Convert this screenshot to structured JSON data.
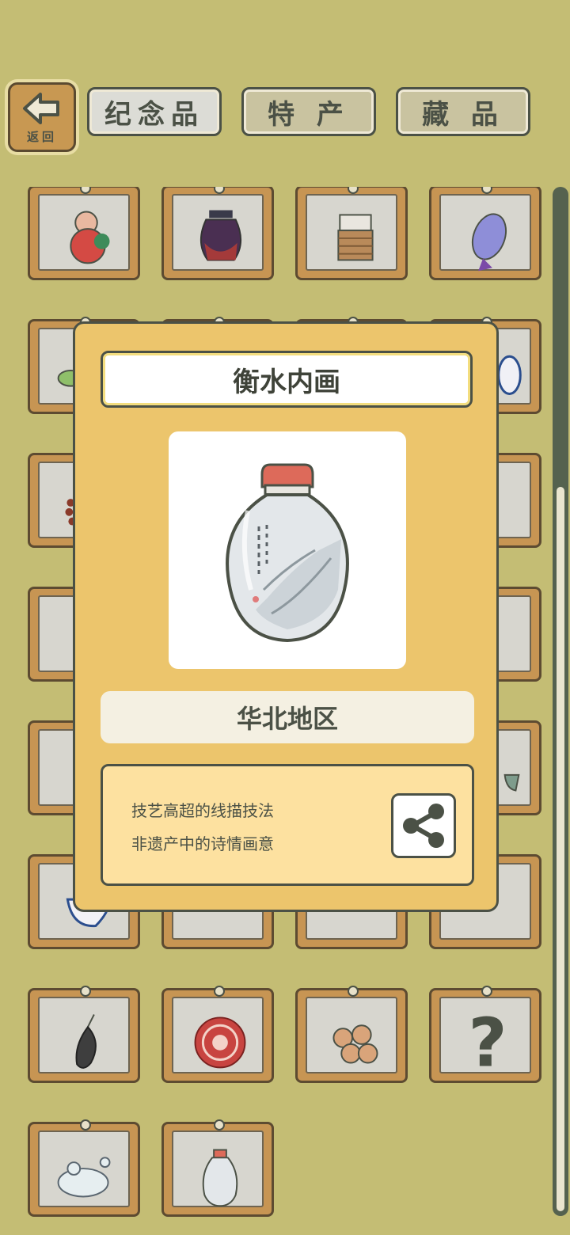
{
  "header": {
    "back_label": "返回",
    "tabs": [
      {
        "label": "纪念品",
        "active": true
      },
      {
        "label": "特 产",
        "active": false
      },
      {
        "label": "藏 品",
        "active": false
      }
    ]
  },
  "grid": {
    "items": [
      {
        "icon": "clay-figure-icon"
      },
      {
        "icon": "black-pot-icon"
      },
      {
        "icon": "wicker-cup-icon"
      },
      {
        "icon": "cloisonne-vase-icon"
      },
      {
        "icon": "jade-bowl-icon"
      },
      {
        "icon": "item-icon"
      },
      {
        "icon": "item-icon"
      },
      {
        "icon": "blue-white-vase-icon"
      },
      {
        "icon": "bead-bracelet-icon"
      },
      {
        "icon": "item-icon"
      },
      {
        "icon": "item-icon"
      },
      {
        "icon": "item-icon"
      },
      {
        "icon": "item-icon"
      },
      {
        "icon": "item-icon"
      },
      {
        "icon": "item-icon"
      },
      {
        "icon": "item-icon"
      },
      {
        "icon": "item-icon"
      },
      {
        "icon": "item-icon"
      },
      {
        "icon": "item-icon"
      },
      {
        "icon": "teacup-icon"
      },
      {
        "icon": "porcelain-bowl-icon"
      },
      {
        "icon": "item-icon"
      },
      {
        "icon": "item-icon"
      },
      {
        "icon": "item-icon"
      },
      {
        "icon": "black-stone-pendant-icon"
      },
      {
        "icon": "red-paper-cut-icon"
      },
      {
        "icon": "dough-rabbits-icon"
      },
      {
        "icon": "unknown-question-icon",
        "unknown": true
      },
      {
        "icon": "jade-frog-icon"
      },
      {
        "icon": "snuff-bottle-icon"
      }
    ]
  },
  "dialog": {
    "title": "衡水内画",
    "region": "华北地区",
    "description": [
      "技艺高超的线描技法",
      "非遗产中的诗情画意"
    ],
    "share_icon": "share-icon"
  },
  "colors": {
    "background": "#c4bd74",
    "dialog": "#ecc56c",
    "desc_box": "#fde1a0",
    "frame": "#c79553",
    "outline": "#4b5146"
  }
}
